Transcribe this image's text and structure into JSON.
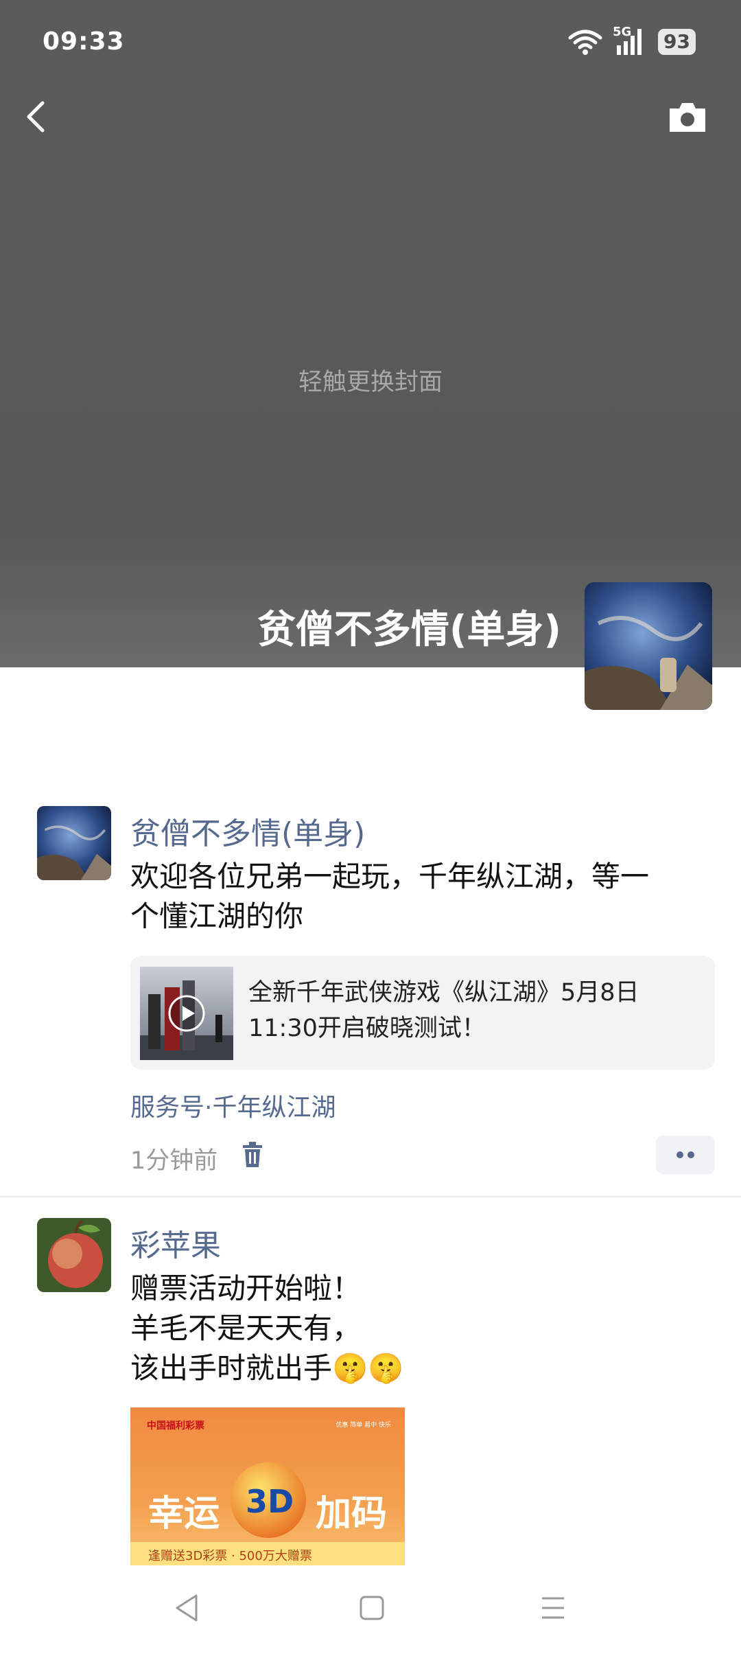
{
  "status_bar": {
    "time": "09:33",
    "network": "5G",
    "battery": "93"
  },
  "cover": {
    "hint": "轻触更换封面"
  },
  "profile": {
    "name": "贫僧不多情(单身)"
  },
  "posts": [
    {
      "author": "贫僧不多情(单身)",
      "text_lines": [
        "欢迎各位兄弟一起玩，千年纵江湖，等一",
        "个懂江湖的你"
      ],
      "link": {
        "title_lines": [
          "全新千年武侠游戏《纵江湖》5月8日",
          "11:30开启破晓测试！"
        ]
      },
      "source": "服务号·千年纵江湖",
      "time": "1分钟前"
    },
    {
      "author": "彩苹果",
      "text_lines": [
        "赠票活动开始啦！",
        "羊毛不是天天有，",
        "该出手时就出手🤫🤫"
      ],
      "image": {
        "brand": "中国福利彩票",
        "tags": "优惠  简单  易中  快乐",
        "headline_left": "幸运",
        "headline_logo": "3D",
        "headline_right": "加码",
        "footer": "逢赠送3D彩票 · 500万大赠票"
      }
    }
  ],
  "icons": {
    "back": "back-arrow-icon",
    "camera": "camera-icon",
    "wifi": "wifi-icon",
    "signal": "signal-icon",
    "battery": "battery-icon",
    "play": "play-icon",
    "trash": "trash-icon",
    "more": "more-dots-icon",
    "nav_back": "nav-back-icon",
    "nav_home": "nav-home-icon",
    "nav_menu": "nav-menu-icon"
  }
}
